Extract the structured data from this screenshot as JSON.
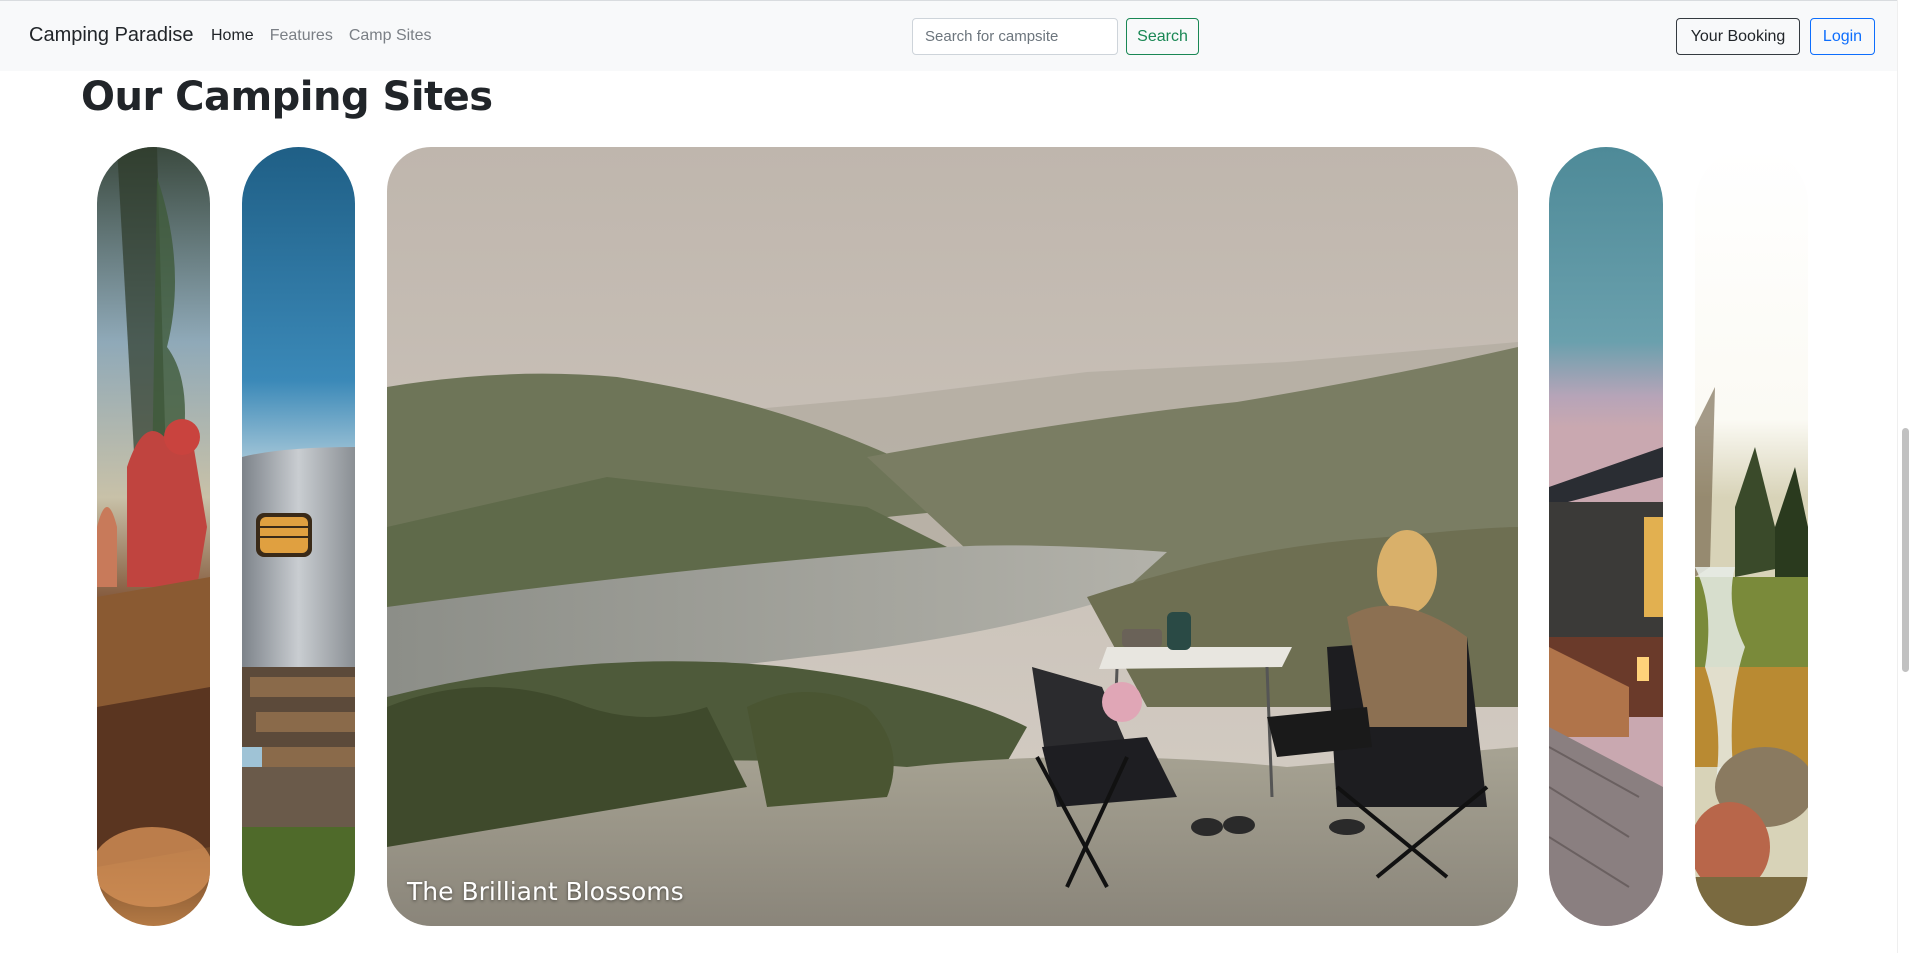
{
  "navbar": {
    "brand": "Camping Paradise",
    "links": [
      {
        "label": "Home",
        "active": true
      },
      {
        "label": "Features",
        "active": false
      },
      {
        "label": "Camp Sites",
        "active": false
      }
    ],
    "search": {
      "placeholder": "Search for campsite",
      "value": "",
      "button_label": "Search"
    },
    "booking_label": "Your Booking",
    "login_label": "Login"
  },
  "section": {
    "title": "Our Camping Sites",
    "featured_caption": "The Brilliant Blossoms"
  },
  "colors": {
    "search_button": "#198754",
    "login_button": "#0d6efd",
    "navbar_bg": "#f8f9fa"
  }
}
